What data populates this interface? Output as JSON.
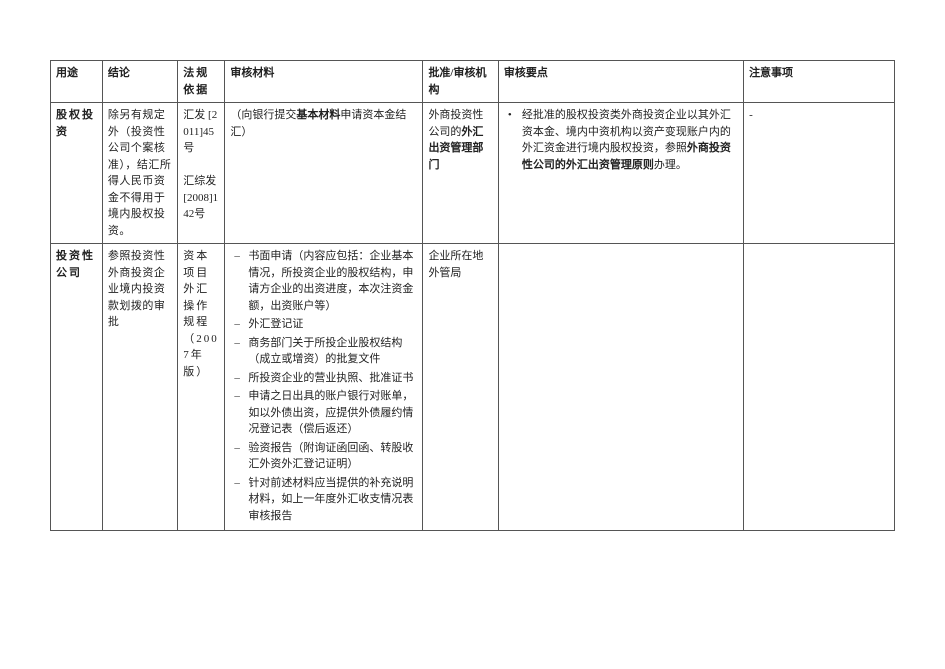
{
  "headers": {
    "purpose": "用途",
    "conclusion": "结论",
    "basis": "法规依据",
    "materials": "审核材料",
    "approver": "批准/审核机构",
    "points": "审核要点",
    "notes": "注意事项"
  },
  "rows": [
    {
      "purpose": "股权投资",
      "conclusion": "除另有规定外（投资性公司个案核准），结汇所得人民币资金不得用于境内股权投资。",
      "basis_a": "汇发 [2011]45号",
      "basis_b": "汇综发 [2008]142号",
      "materials_prefix": "（向银行提交",
      "materials_bold": "基本材料",
      "materials_suffix": "申请资本金结汇）",
      "approver_prefix": "外商投资性公司的",
      "approver_bold": "外汇出资管理部门",
      "points_prefix": "经批准的股权投资类外商投资企业以其外汇资本金、境内中资机构以资产变现账户内的外汇资金进行境内股权投资，参照",
      "points_bold": "外商投资性公司的外汇出资管理原则",
      "points_suffix": "办理。",
      "notes": "-"
    },
    {
      "purpose": "投资性公司",
      "conclusion": "参照投资性外商投资企业境内投资款划拨的审批",
      "basis": "资本项目外汇操作规程（2007年版）",
      "materials_list": [
        "书面申请（内容应包括：企业基本情况，所投资企业的股权结构，申请方企业的出资进度，本次注资金额，出资账户等）",
        "外汇登记证",
        "商务部门关于所投企业股权结构（成立或增资）的批复文件",
        "所投资企业的营业执照、批准证书",
        "申请之日出具的账户银行对账单，如以外债出资，应提供外债履约情况登记表（偿后返还）",
        "验资报告（附询证函回函、转股收汇外资外汇登记证明）",
        "针对前述材料应当提供的补充说明材料，如上一年度外汇收支情况表审核报告"
      ],
      "approver": "企业所在地外管局",
      "points": "",
      "notes": ""
    }
  ]
}
